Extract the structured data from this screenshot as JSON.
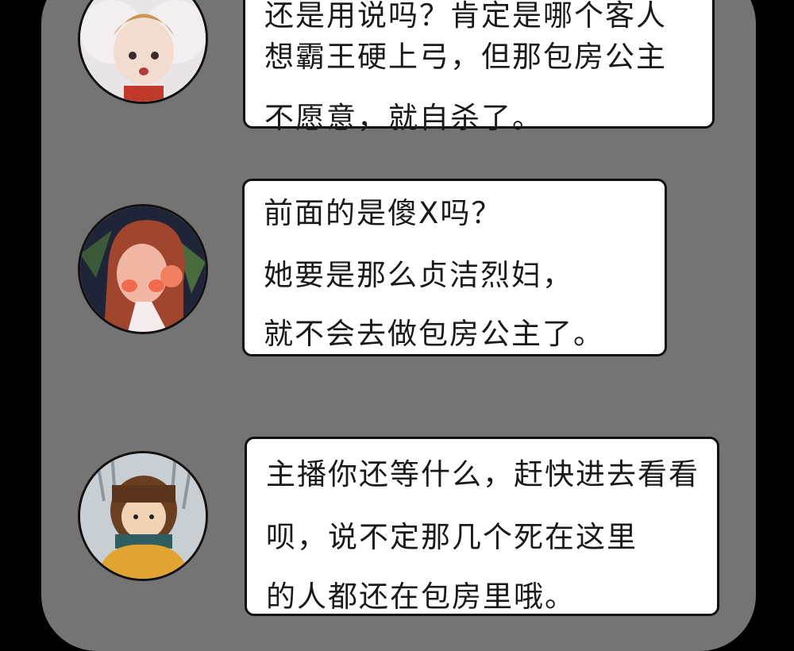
{
  "messages": [
    {
      "avatar": "avatar-girl-white-hood",
      "lines": [
        "还是用说吗？肯定是哪个客人",
        "想霸王硬上弓，但那包房公主",
        "不愿意，就自杀了。"
      ]
    },
    {
      "avatar": "avatar-red-hair-woman",
      "lines": [
        "前面的是傻X吗？",
        "她要是那么贞洁烈妇，",
        "就不会去做包房公主了。"
      ]
    },
    {
      "avatar": "avatar-antler-scarf",
      "lines": [
        "主播你还等什么，赶快进去看看",
        "呗，说不定那几个死在这里",
        "的人都还在包房里哦。"
      ]
    }
  ]
}
